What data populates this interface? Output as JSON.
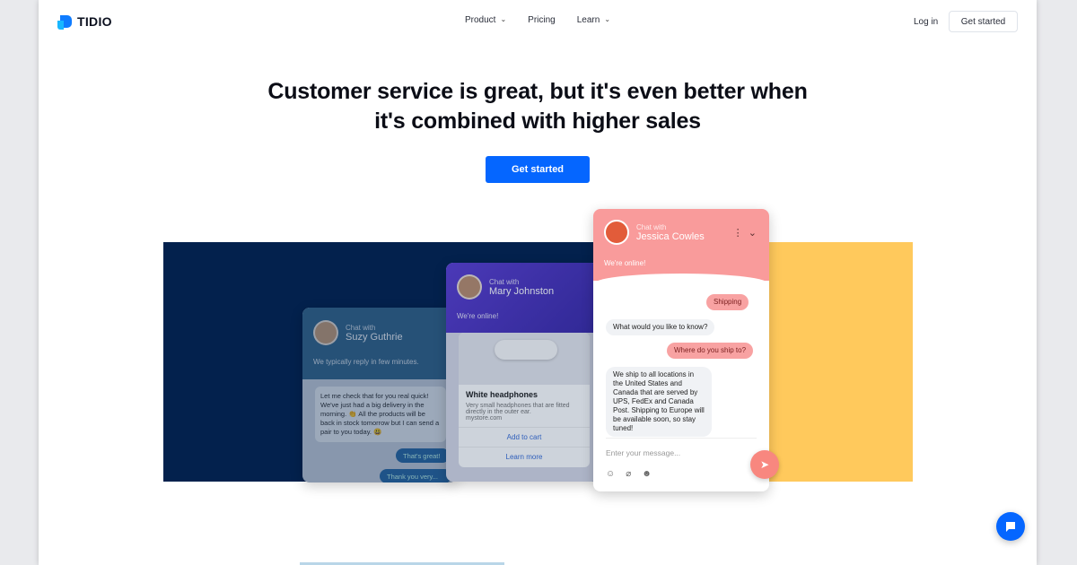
{
  "header": {
    "brand": "TIDIO",
    "nav": [
      {
        "label": "Product",
        "has_dropdown": true
      },
      {
        "label": "Pricing",
        "has_dropdown": false
      },
      {
        "label": "Learn",
        "has_dropdown": true
      }
    ],
    "login": "Log in",
    "get_started": "Get started"
  },
  "hero": {
    "line1_pre": "Customer service is great, but it's ",
    "line1_bold": "even better",
    "line1_post": " when",
    "line2": "it's combined with higher sales",
    "cta": "Get started"
  },
  "chats": {
    "suzy": {
      "chat_with": "Chat with",
      "name": "Suzy Guthrie",
      "status": "We typically reply in few minutes.",
      "message": "Let me check that for you real quick! We've just had a big delivery in the morning. 👏 All the products will be back in stock tomorrow but I can send a pair to you today. 😃",
      "reply1": "That's great!",
      "reply2": "Thank you very..."
    },
    "mary": {
      "chat_with": "Chat with",
      "name": "Mary Johnston",
      "status": "We're online!",
      "product_title": "White headphones",
      "product_desc": "Very small headphones that are fitted directly in the outer ear.",
      "product_store": "mystore.com",
      "add_to_cart": "Add to cart",
      "learn_more": "Learn more"
    },
    "jessica": {
      "chat_with": "Chat with",
      "name": "Jessica Cowles",
      "status": "We're online!",
      "messages": [
        {
          "from": "visitor",
          "text": "Shipping"
        },
        {
          "from": "operator",
          "text": "What would you like to know?"
        },
        {
          "from": "visitor",
          "text": "Where do you ship to?"
        },
        {
          "from": "operator",
          "text": "We ship to all locations in the United States and Canada that are served by UPS, FedEx and Canada Post. Shipping to Europe will be available soon, so stay tuned!"
        }
      ],
      "input_placeholder": "Enter your message..."
    }
  },
  "colors": {
    "accent": "#0566ff",
    "navy": "#03214d",
    "yellow": "#ffc95c",
    "coral": "#f99b9b"
  }
}
